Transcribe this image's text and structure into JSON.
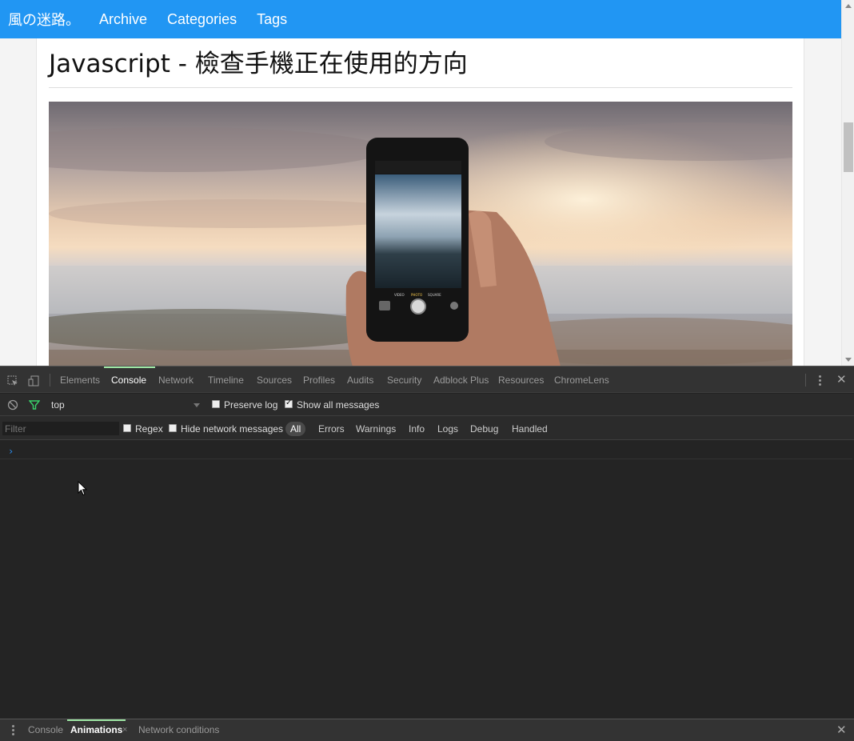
{
  "navbar": {
    "brand": "風の迷路。",
    "links": [
      "Archive",
      "Categories",
      "Tags"
    ]
  },
  "post": {
    "title": "Javascript - 檢查手機正在使用的方向",
    "hero_image_description_icon": "phone-photo-icon"
  },
  "phone_screen": {
    "labels": [
      "VIDEO",
      "PHOTO",
      "SQUARE"
    ]
  },
  "devtools": {
    "tabs": [
      "Elements",
      "Console",
      "Network",
      "Timeline",
      "Sources",
      "Profiles",
      "Audits",
      "Security",
      "Adblock Plus",
      "Resources",
      "ChromeLens"
    ],
    "active_tab": "Console",
    "context": "top",
    "preserve_log_label": "Preserve log",
    "preserve_log_checked": false,
    "show_all_label": "Show all messages",
    "show_all_checked": true,
    "filter_placeholder": "Filter",
    "regex_label": "Regex",
    "hide_network_label": "Hide network messages",
    "levels": [
      "All",
      "Errors",
      "Warnings",
      "Info",
      "Logs",
      "Debug",
      "Handled"
    ],
    "active_level": "All",
    "prompt": "›",
    "drawer_tabs": [
      "Console",
      "Animations",
      "Network conditions"
    ],
    "active_drawer_tab": "Animations",
    "drawer_tab_close": "×",
    "close": "✕"
  },
  "colors": {
    "navbar": "#2196f3",
    "active_tab_indicator": "#9ee6a4",
    "devtools_bg": "#242424"
  }
}
